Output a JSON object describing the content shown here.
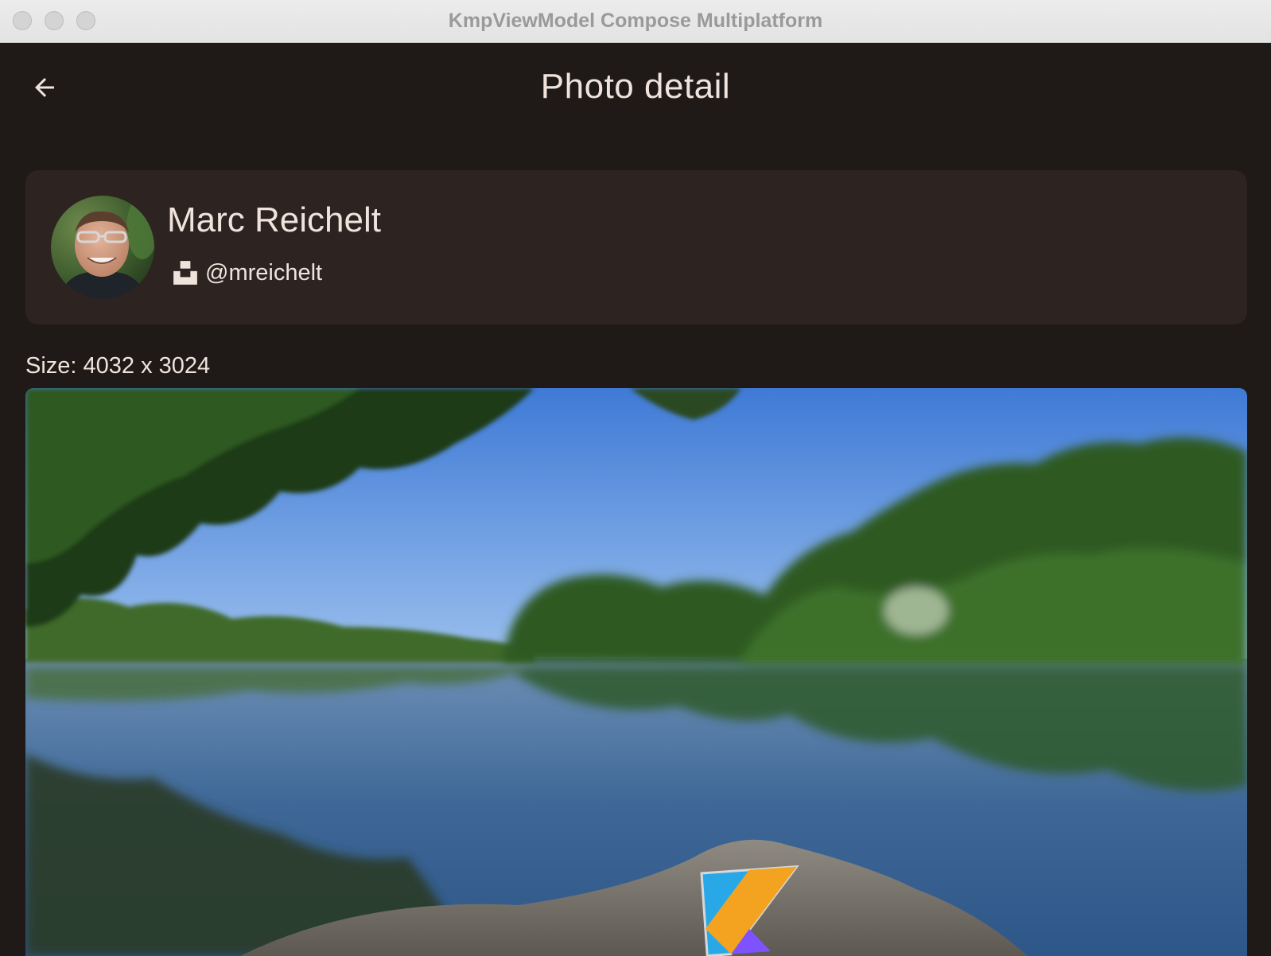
{
  "window": {
    "title": "KmpViewModel Compose Multiplatform"
  },
  "appbar": {
    "title": "Photo detail",
    "back_icon": "arrow-back-icon"
  },
  "author": {
    "name": "Marc Reichelt",
    "handle": "@mreichelt",
    "handle_icon": "unsplash-icon"
  },
  "photo": {
    "size_label": "Size: 4032 x 3024",
    "description": ""
  },
  "colors": {
    "background": "#1f1a17",
    "card": "#2d2320",
    "text": "#efe3dc"
  }
}
